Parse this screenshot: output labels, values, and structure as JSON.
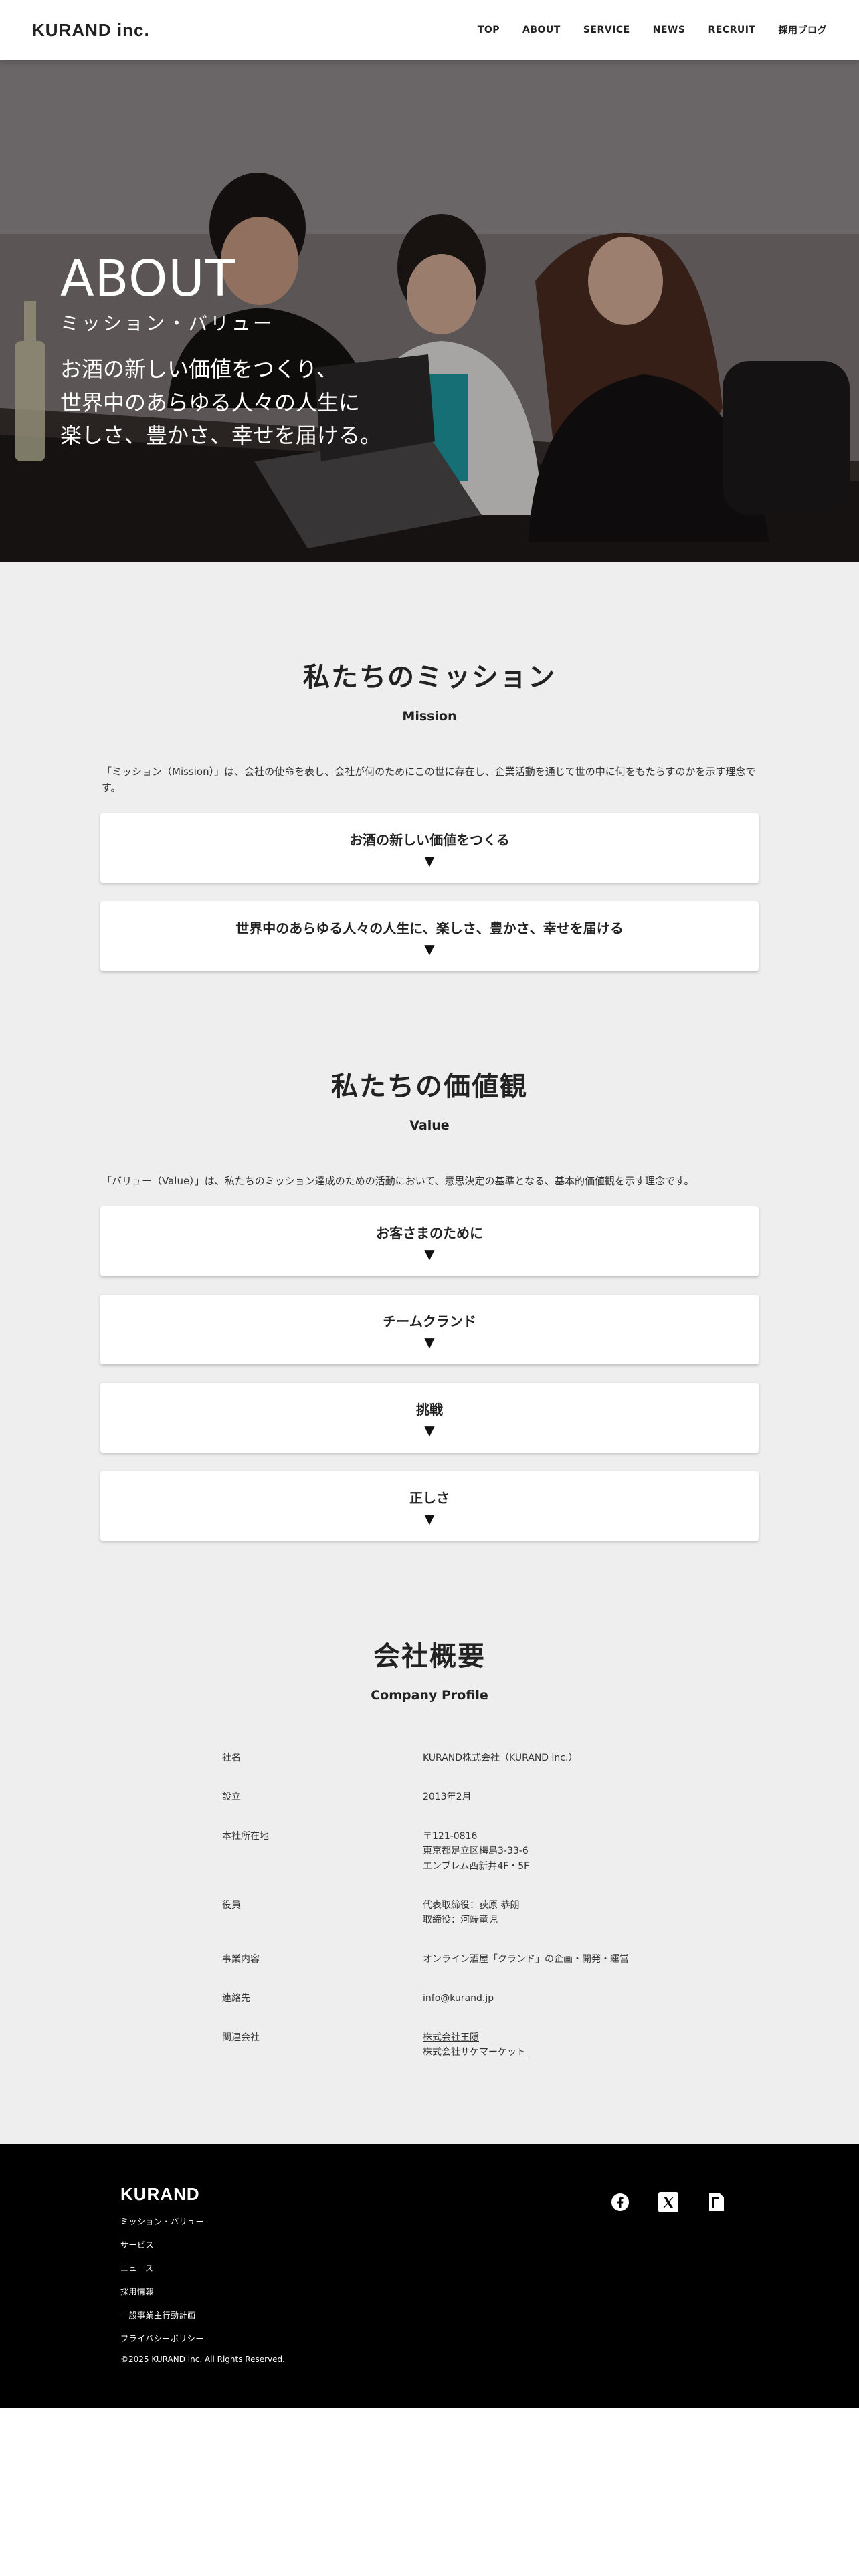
{
  "header": {
    "logo": "KURAND inc.",
    "nav": [
      "TOP",
      "ABOUT",
      "SERVICE",
      "NEWS",
      "RECRUIT",
      "採用ブログ"
    ]
  },
  "hero": {
    "title": "ABOUT",
    "subtitle": "ミッション・バリュー",
    "message_lines": [
      "お酒の新しい価値をつくり、",
      "世界中のあらゆる人々の人生に",
      "楽しさ、豊かさ、幸せを届ける。"
    ]
  },
  "mission": {
    "title": "私たちのミッション",
    "subtitle": "Mission",
    "description": "「ミッション（Mission）」は、会社の使命を表し、会社が何のためにこの世に存在し、企業活動を通じて世の中に何をもたらすのかを示す理念です。",
    "items": [
      "お酒の新しい価値をつくる",
      "世界中のあらゆる人々の人生に、楽しさ、豊かさ、幸せを届ける"
    ]
  },
  "values": {
    "title": "私たちの価値観",
    "subtitle": "Value",
    "description": "「バリュー（Value）」は、私たちのミッション達成のための活動において、意思決定の基準となる、基本的価値観を示す理念です。",
    "items": [
      "お客さまのために",
      "チームクランド",
      "挑戦",
      "正しさ"
    ]
  },
  "arrow": "▼",
  "profile": {
    "title": "会社概要",
    "subtitle": "Company Profile",
    "rows": [
      {
        "key": "社名",
        "value": [
          "KURAND株式会社（KURAND inc.）"
        ]
      },
      {
        "key": "設立",
        "value": [
          "2013年2月"
        ]
      },
      {
        "key": "本社所在地",
        "value": [
          "〒121-0816",
          "東京都足立区梅島3-33-6",
          "エンブレム西新井4F・5F"
        ]
      },
      {
        "key": "役員",
        "value": [
          "代表取締役：荻原 恭朗",
          "取締役：河端竜児"
        ]
      },
      {
        "key": "事業内容",
        "value": [
          "オンライン酒屋「クランド」の企画・開発・運営"
        ]
      },
      {
        "key": "連絡先",
        "value": [
          "info@kurand.jp"
        ]
      },
      {
        "key": "関連会社",
        "links": [
          "株式会社王隠",
          "株式会社サケマーケット"
        ]
      }
    ]
  },
  "footer": {
    "logo": "KURAND",
    "links": [
      "ミッション・バリュー",
      "サービス",
      "ニュース",
      "採用情報",
      "一般事業主行動計画",
      "プライバシーポリシー"
    ],
    "copyright": "©2025 KURAND inc. All Rights Reserved.",
    "social": [
      "facebook-icon",
      "x-icon",
      "note-icon"
    ]
  }
}
